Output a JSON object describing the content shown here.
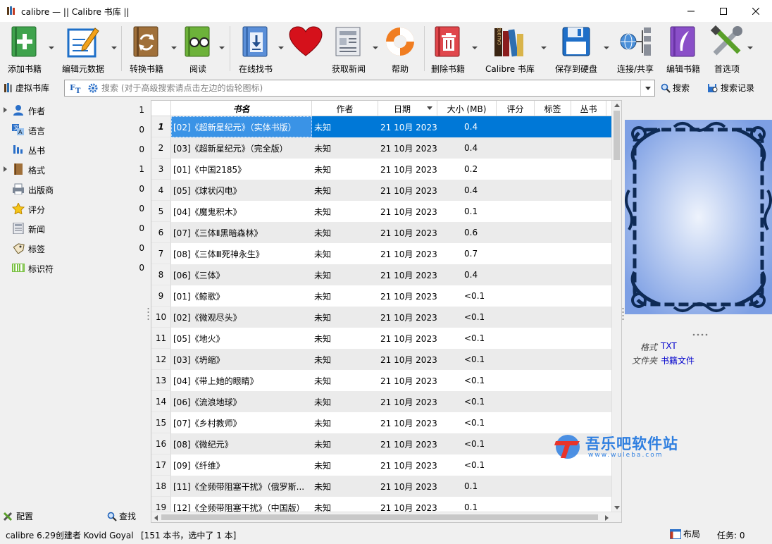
{
  "window": {
    "title": "calibre — || Calibre 书库 ||"
  },
  "toolbar": {
    "add": "添加书籍",
    "edit_meta": "编辑元数据",
    "convert": "转换书籍",
    "view": "阅读",
    "get_books": "在线找书",
    "fetch_news": "获取新闻",
    "help": "帮助",
    "remove": "删除书籍",
    "library": "Calibre 书库",
    "save": "保存到硬盘",
    "connect": "连接/共享",
    "edit_book": "编辑书籍",
    "prefs": "首选项"
  },
  "search": {
    "virtual_library": "虚拟书库",
    "placeholder": "搜索 (对于高级搜索请点击左边的齿轮图标)",
    "search_btn": "搜索",
    "history_btn": "搜索记录"
  },
  "tag_browser": {
    "items": [
      {
        "label": "作者",
        "count": "1"
      },
      {
        "label": "语言",
        "count": "0"
      },
      {
        "label": "丛书",
        "count": "0"
      },
      {
        "label": "格式",
        "count": "1"
      },
      {
        "label": "出版商",
        "count": "0"
      },
      {
        "label": "评分",
        "count": "0"
      },
      {
        "label": "新闻",
        "count": "0"
      },
      {
        "label": "标签",
        "count": "0"
      },
      {
        "label": "标识符",
        "count": "0"
      }
    ],
    "configure": "配置",
    "find": "查找"
  },
  "table": {
    "columns": [
      "书名",
      "作者",
      "日期",
      "大小 (MB)",
      "评分",
      "标签",
      "丛书"
    ],
    "rows": [
      {
        "n": "1",
        "title": "[02]《超新星纪元》（实体书版）",
        "author": "未知",
        "date": "21 10月 2023",
        "size": "0.4"
      },
      {
        "n": "2",
        "title": "[03]《超新星纪元》（完全版）",
        "author": "未知",
        "date": "21 10月 2023",
        "size": "0.4"
      },
      {
        "n": "3",
        "title": "[01]《中国2185》",
        "author": "未知",
        "date": "21 10月 2023",
        "size": "0.2"
      },
      {
        "n": "4",
        "title": "[05]《球状闪电》",
        "author": "未知",
        "date": "21 10月 2023",
        "size": "0.4"
      },
      {
        "n": "5",
        "title": "[04]《魔鬼积木》",
        "author": "未知",
        "date": "21 10月 2023",
        "size": "0.1"
      },
      {
        "n": "6",
        "title": "[07]《三体Ⅱ黑暗森林》",
        "author": "未知",
        "date": "21 10月 2023",
        "size": "0.6"
      },
      {
        "n": "7",
        "title": "[08]《三体Ⅲ死神永生》",
        "author": "未知",
        "date": "21 10月 2023",
        "size": "0.7"
      },
      {
        "n": "8",
        "title": "[06]《三体》",
        "author": "未知",
        "date": "21 10月 2023",
        "size": "0.4"
      },
      {
        "n": "9",
        "title": "[01]《鲸歌》",
        "author": "未知",
        "date": "21 10月 2023",
        "size": "<0.1"
      },
      {
        "n": "10",
        "title": "[02]《微观尽头》",
        "author": "未知",
        "date": "21 10月 2023",
        "size": "<0.1"
      },
      {
        "n": "11",
        "title": "[05]《地火》",
        "author": "未知",
        "date": "21 10月 2023",
        "size": "<0.1"
      },
      {
        "n": "12",
        "title": "[03]《坍缩》",
        "author": "未知",
        "date": "21 10月 2023",
        "size": "<0.1"
      },
      {
        "n": "13",
        "title": "[04]《带上她的眼睛》",
        "author": "未知",
        "date": "21 10月 2023",
        "size": "<0.1"
      },
      {
        "n": "14",
        "title": "[06]《流浪地球》",
        "author": "未知",
        "date": "21 10月 2023",
        "size": "<0.1"
      },
      {
        "n": "15",
        "title": "[07]《乡村教师》",
        "author": "未知",
        "date": "21 10月 2023",
        "size": "<0.1"
      },
      {
        "n": "16",
        "title": "[08]《微纪元》",
        "author": "未知",
        "date": "21 10月 2023",
        "size": "<0.1"
      },
      {
        "n": "17",
        "title": "[09]《纤维》",
        "author": "未知",
        "date": "21 10月 2023",
        "size": "<0.1"
      },
      {
        "n": "18",
        "title": "[11]《全频带阻塞干扰》（俄罗斯...",
        "author": "未知",
        "date": "21 10月 2023",
        "size": "0.1"
      },
      {
        "n": "19",
        "title": "[12]《全频带阻塞干扰》（中国版）",
        "author": "未知",
        "date": "21 10月 2023",
        "size": "0.1"
      }
    ]
  },
  "details": {
    "format_key": "格式",
    "format_val": "TXT",
    "folder_key": "文件夹",
    "folder_val": "书籍文件"
  },
  "watermark": {
    "name": "吾乐吧软件站",
    "url": "www.wuleba.com"
  },
  "status": {
    "left": "calibre 6.29创建者 Kovid Goyal",
    "count": "[151 本书，选中了 1 本]",
    "layout": "布局",
    "jobs": "任务:  0"
  },
  "colors": {
    "selection": "#0078d7",
    "link": "#0000cc"
  }
}
